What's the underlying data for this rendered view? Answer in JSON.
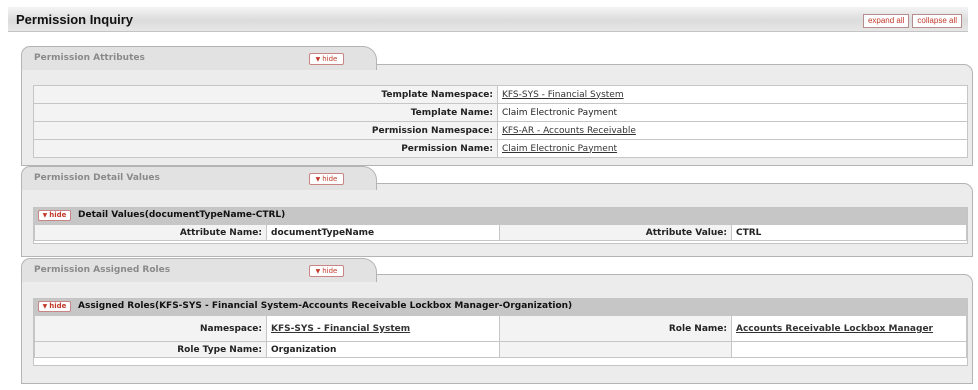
{
  "header": {
    "title": "Permission Inquiry",
    "expand_all": "expand all",
    "collapse_all": "collapse all"
  },
  "hide_label": "hide",
  "sections": {
    "attributes": {
      "tab_label": "Permission Attributes",
      "rows": [
        {
          "label": "Template Namespace:",
          "value": "KFS-SYS - Financial System"
        },
        {
          "label": "Template Name:",
          "value": "Claim Electronic Payment"
        },
        {
          "label": "Permission Namespace:",
          "value": "KFS-AR - Accounts Receivable"
        },
        {
          "label": "Permission Name:",
          "value": "Claim Electronic Payment"
        }
      ]
    },
    "details": {
      "tab_label": "Permission Detail Values",
      "sub_title": "Detail Values(documentTypeName-CTRL)",
      "attr_name_label": "Attribute Name:",
      "attr_name_value": "documentTypeName",
      "attr_value_label": "Attribute Value:",
      "attr_value_value": "CTRL"
    },
    "roles": {
      "tab_label": "Permission Assigned Roles",
      "sub_title": "Assigned Roles(KFS-SYS - Financial System-Accounts Receivable Lockbox Manager-Organization)",
      "namespace_label": "Namespace:",
      "namespace_value": "KFS-SYS - Financial System",
      "role_name_label": "Role Name:",
      "role_name_value": "Accounts Receivable Lockbox Manager",
      "role_type_label": "Role Type Name:",
      "role_type_value": "Organization"
    }
  }
}
